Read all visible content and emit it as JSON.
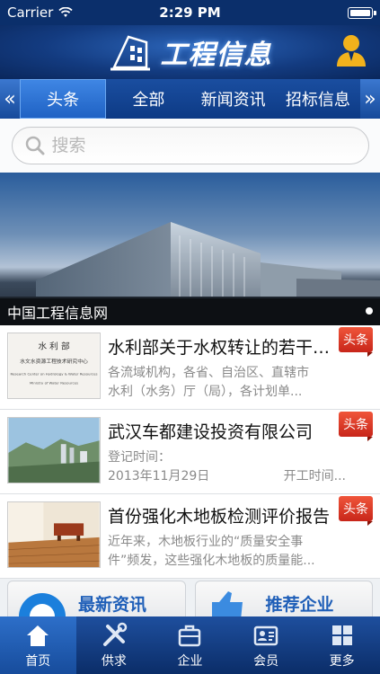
{
  "status_bar": {
    "carrier": "Carrier",
    "time": "2:29 PM"
  },
  "header": {
    "app_title": "工程信息"
  },
  "tabs": {
    "prev_arrow": "«",
    "next_arrow": "»",
    "items": [
      {
        "label": "头条",
        "active": true
      },
      {
        "label": "全部",
        "active": false
      },
      {
        "label": "新闻资讯",
        "active": false
      },
      {
        "label": "招标信息",
        "active": false
      }
    ]
  },
  "search": {
    "placeholder": "搜索"
  },
  "banner": {
    "caption": "中国工程信息网"
  },
  "news": [
    {
      "title": "水利部关于水权转让的若干意见",
      "desc_line1": "各流域机构，各省、自治区、直辖市",
      "desc_line2": "水利（水务）厅（局），各计划单...",
      "badge": "头条",
      "thumb_text_top": "水 利 部",
      "thumb_text_mid": "水文水资源工程技术研究中心",
      "thumb_text_en1": "Research Center on Hydrology & Water Resources",
      "thumb_text_en2": "Ministry of Water Resources"
    },
    {
      "title": "武汉车都建设投资有限公司",
      "desc_line1": "登记时间：",
      "desc_line2a": "2013年11月29日",
      "desc_line2b": "开工时间...",
      "badge": "头条"
    },
    {
      "title": "首份强化木地板检测评价报告",
      "desc_line1": "近年来，木地板行业的“质量安全事",
      "desc_line2": "件”频发，这些强化木地板的质量能...",
      "badge": "头条"
    }
  ],
  "cards": [
    {
      "label": "最新资讯"
    },
    {
      "label": "推荐企业"
    }
  ],
  "tabbar": [
    {
      "label": "首页",
      "active": true
    },
    {
      "label": "供求",
      "active": false
    },
    {
      "label": "企业",
      "active": false
    },
    {
      "label": "会员",
      "active": false
    },
    {
      "label": "更多",
      "active": false
    }
  ],
  "colors": {
    "primary": "#0d3a85",
    "badge": "#e0402a",
    "card_text": "#1f5fb8"
  }
}
